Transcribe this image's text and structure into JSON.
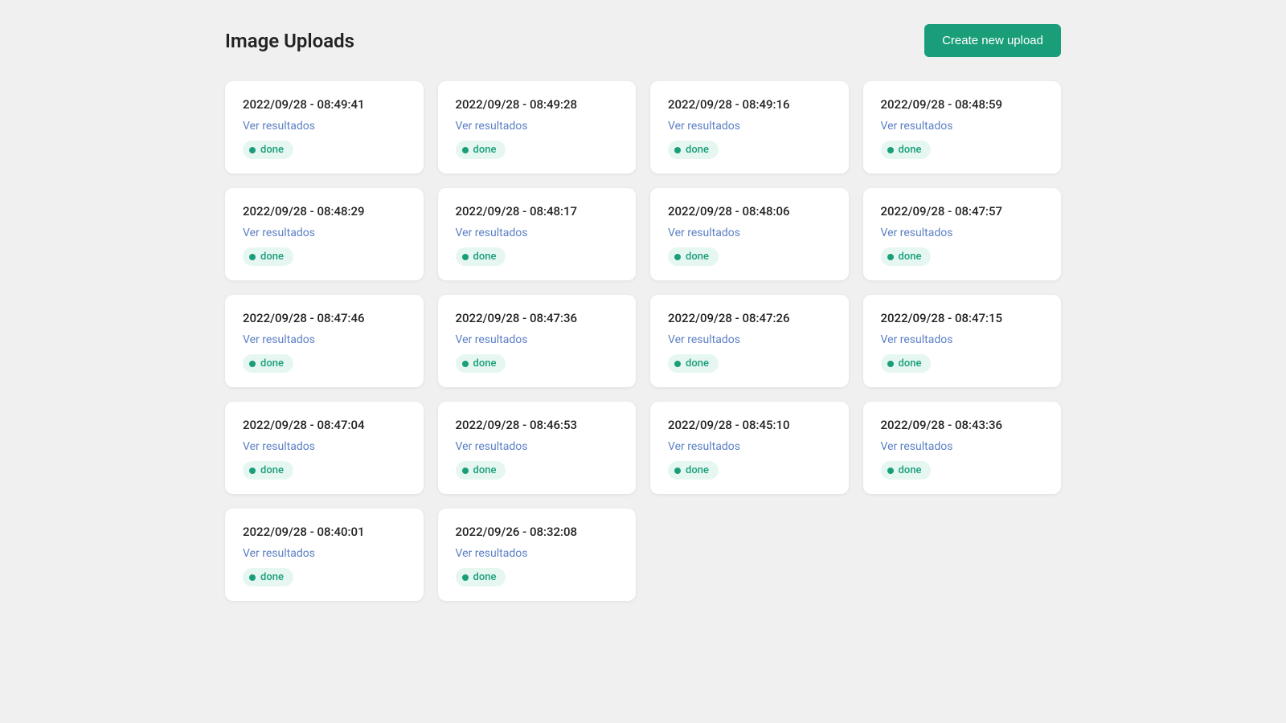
{
  "header": {
    "title": "Image Uploads",
    "create_button_label": "Create new upload"
  },
  "cards": [
    {
      "timestamp": "2022/09/28 - 08:49:41",
      "link_label": "Ver resultados",
      "status": "done"
    },
    {
      "timestamp": "2022/09/28 - 08:49:28",
      "link_label": "Ver resultados",
      "status": "done"
    },
    {
      "timestamp": "2022/09/28 - 08:49:16",
      "link_label": "Ver resultados",
      "status": "done"
    },
    {
      "timestamp": "2022/09/28 - 08:48:59",
      "link_label": "Ver resultados",
      "status": "done"
    },
    {
      "timestamp": "2022/09/28 - 08:48:29",
      "link_label": "Ver resultados",
      "status": "done"
    },
    {
      "timestamp": "2022/09/28 - 08:48:17",
      "link_label": "Ver resultados",
      "status": "done"
    },
    {
      "timestamp": "2022/09/28 - 08:48:06",
      "link_label": "Ver resultados",
      "status": "done"
    },
    {
      "timestamp": "2022/09/28 - 08:47:57",
      "link_label": "Ver resultados",
      "status": "done"
    },
    {
      "timestamp": "2022/09/28 - 08:47:46",
      "link_label": "Ver resultados",
      "status": "done"
    },
    {
      "timestamp": "2022/09/28 - 08:47:36",
      "link_label": "Ver resultados",
      "status": "done"
    },
    {
      "timestamp": "2022/09/28 - 08:47:26",
      "link_label": "Ver resultados",
      "status": "done"
    },
    {
      "timestamp": "2022/09/28 - 08:47:15",
      "link_label": "Ver resultados",
      "status": "done"
    },
    {
      "timestamp": "2022/09/28 - 08:47:04",
      "link_label": "Ver resultados",
      "status": "done"
    },
    {
      "timestamp": "2022/09/28 - 08:46:53",
      "link_label": "Ver resultados",
      "status": "done"
    },
    {
      "timestamp": "2022/09/28 - 08:45:10",
      "link_label": "Ver resultados",
      "status": "done"
    },
    {
      "timestamp": "2022/09/28 - 08:43:36",
      "link_label": "Ver resultados",
      "status": "done"
    },
    {
      "timestamp": "2022/09/28 - 08:40:01",
      "link_label": "Ver resultados",
      "status": "done"
    },
    {
      "timestamp": "2022/09/26 - 08:32:08",
      "link_label": "Ver resultados",
      "status": "done"
    }
  ]
}
